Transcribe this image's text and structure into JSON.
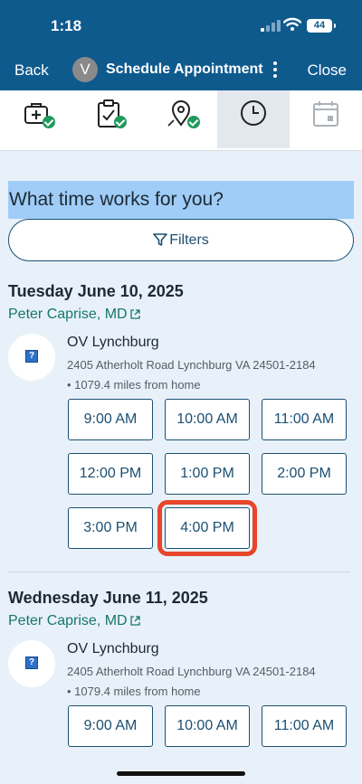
{
  "status_bar": {
    "time": "1:18",
    "battery": "44"
  },
  "nav": {
    "back_label": "Back",
    "avatar_initial": "V",
    "title": "Schedule Appointment",
    "close_label": "Close"
  },
  "steps": [
    {
      "icon": "medical-bag-icon",
      "completed": true
    },
    {
      "icon": "clipboard-check-icon",
      "completed": true
    },
    {
      "icon": "location-pin-icon",
      "completed": true
    },
    {
      "icon": "clock-icon",
      "current": true
    },
    {
      "icon": "calendar-icon",
      "completed": false
    }
  ],
  "page": {
    "heading": "What time works for you?",
    "filters_label": "Filters"
  },
  "days": [
    {
      "title": "Tuesday June 10, 2025",
      "provider": "Peter Caprise, MD",
      "location": {
        "name": "OV Lynchburg",
        "address": "2405 Atherholt Road Lynchburg VA 24501-2184",
        "distance": "• 1079.4 miles from home"
      },
      "slots": [
        "9:00 AM",
        "10:00 AM",
        "11:00 AM",
        "12:00 PM",
        "1:00 PM",
        "2:00 PM",
        "3:00 PM",
        "4:00 PM"
      ]
    },
    {
      "title": "Wednesday June 11, 2025",
      "provider": "Peter Caprise, MD",
      "location": {
        "name": "OV Lynchburg",
        "address": "2405 Atherholt Road Lynchburg VA 24501-2184",
        "distance": "• 1079.4 miles from home"
      },
      "slots": [
        "9:00 AM",
        "10:00 AM",
        "11:00 AM"
      ]
    }
  ],
  "highlight_color": "#e8452a",
  "primary_color": "#0f5a8d"
}
